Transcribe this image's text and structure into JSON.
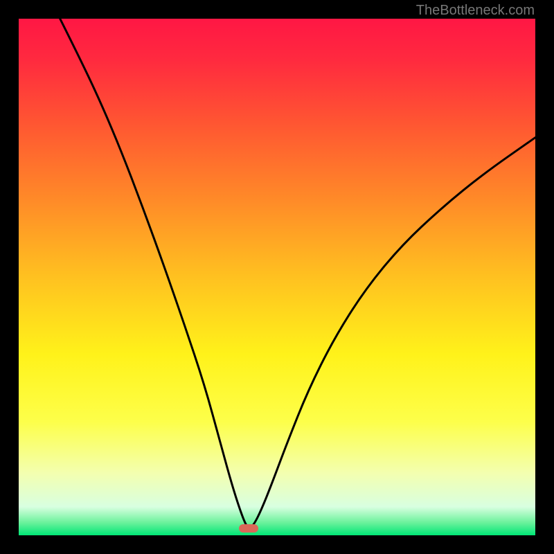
{
  "watermark": "TheBottleneck.com",
  "colors": {
    "frame": "#000000",
    "marker": "#d96858",
    "curve": "#000000",
    "gradient_stops": [
      {
        "offset": 0.0,
        "color": "#ff1744"
      },
      {
        "offset": 0.08,
        "color": "#ff2a3f"
      },
      {
        "offset": 0.2,
        "color": "#ff5532"
      },
      {
        "offset": 0.35,
        "color": "#ff8a28"
      },
      {
        "offset": 0.5,
        "color": "#ffc120"
      },
      {
        "offset": 0.65,
        "color": "#fff21a"
      },
      {
        "offset": 0.78,
        "color": "#fdff4a"
      },
      {
        "offset": 0.88,
        "color": "#f3ffb0"
      },
      {
        "offset": 0.945,
        "color": "#d8ffe0"
      },
      {
        "offset": 0.975,
        "color": "#6cf29c"
      },
      {
        "offset": 1.0,
        "color": "#00e676"
      }
    ]
  },
  "chart_data": {
    "type": "line",
    "title": "",
    "xlabel": "",
    "ylabel": "",
    "xlim": [
      0,
      100
    ],
    "ylim": [
      0,
      100
    ],
    "marker": {
      "x": 44.5,
      "y": 1.3
    },
    "series": [
      {
        "name": "bottleneck-curve",
        "points": [
          {
            "x": 8.0,
            "y": 100.0
          },
          {
            "x": 12.0,
            "y": 92.0
          },
          {
            "x": 16.0,
            "y": 83.5
          },
          {
            "x": 20.0,
            "y": 74.0
          },
          {
            "x": 24.0,
            "y": 63.5
          },
          {
            "x": 28.0,
            "y": 52.5
          },
          {
            "x": 32.0,
            "y": 41.0
          },
          {
            "x": 36.0,
            "y": 29.0
          },
          {
            "x": 39.0,
            "y": 18.0
          },
          {
            "x": 41.5,
            "y": 9.0
          },
          {
            "x": 43.5,
            "y": 3.0
          },
          {
            "x": 44.5,
            "y": 1.2
          },
          {
            "x": 45.5,
            "y": 2.0
          },
          {
            "x": 47.0,
            "y": 5.0
          },
          {
            "x": 49.0,
            "y": 10.0
          },
          {
            "x": 52.0,
            "y": 18.0
          },
          {
            "x": 56.0,
            "y": 28.0
          },
          {
            "x": 61.0,
            "y": 38.0
          },
          {
            "x": 67.0,
            "y": 47.5
          },
          {
            "x": 74.0,
            "y": 56.0
          },
          {
            "x": 82.0,
            "y": 63.5
          },
          {
            "x": 90.0,
            "y": 70.0
          },
          {
            "x": 100.0,
            "y": 77.0
          }
        ]
      }
    ]
  }
}
